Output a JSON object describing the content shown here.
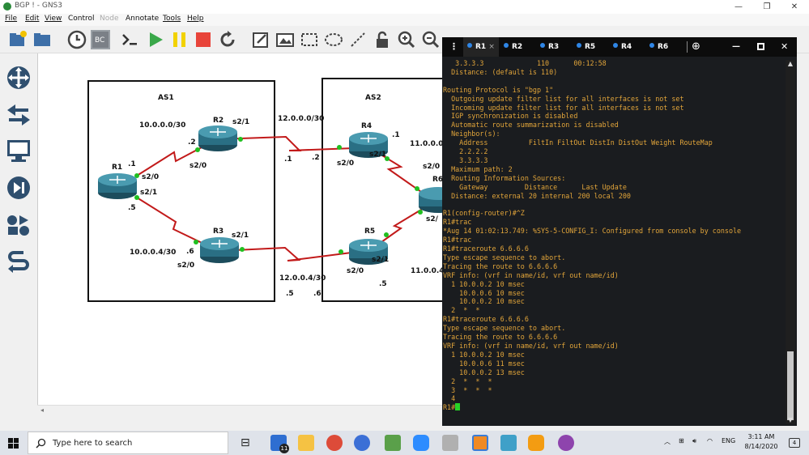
{
  "window": {
    "title": "BGP ! - GNS3",
    "min": "—",
    "restore": "❐",
    "close": "✕"
  },
  "menu": [
    "File",
    "Edit",
    "View",
    "Control",
    "Node",
    "Annotate",
    "Tools",
    "Help"
  ],
  "topology": {
    "labels": [
      {
        "text": "AS1"
      },
      {
        "text": "AS2"
      },
      {
        "text": "R1"
      },
      {
        "text": "R2"
      },
      {
        "text": "R3"
      },
      {
        "text": "R4"
      },
      {
        "text": "R5"
      },
      {
        "text": "R6"
      },
      {
        "text": "10.0.0.0/30"
      },
      {
        "text": "10.0.0.4/30"
      },
      {
        "text": "12.0.0.0/30"
      },
      {
        "text": "12.0.0.4/30"
      },
      {
        "text": "11.0.0.0/"
      },
      {
        "text": "11.0.0.4"
      },
      {
        "text": ".1"
      },
      {
        "text": ".5"
      },
      {
        "text": ".2"
      },
      {
        "text": ".6"
      },
      {
        "text": ".1"
      },
      {
        "text": ".2"
      },
      {
        "text": ".1"
      },
      {
        "text": ".5"
      },
      {
        "text": ".5"
      },
      {
        "text": ".6"
      },
      {
        "text": "s2/0"
      },
      {
        "text": "s2/1"
      },
      {
        "text": "s2/1"
      },
      {
        "text": "s2/0"
      },
      {
        "text": "s2/1"
      },
      {
        "text": "s2/0"
      },
      {
        "text": "s2/0"
      },
      {
        "text": "s2/1"
      },
      {
        "text": "s2/0"
      },
      {
        "text": "s2/1"
      },
      {
        "text": "s2/0"
      },
      {
        "text": "s2/"
      }
    ]
  },
  "console": {
    "tabs": [
      "R1",
      "R2",
      "R3",
      "R5",
      "R4",
      "R6"
    ],
    "close_x": "×",
    "add": "⊕",
    "lines": [
      "   3.3.3.3             110      00:12:58",
      "  Distance: (default is 110)",
      "",
      "Routing Protocol is \"bgp 1\"",
      "  Outgoing update filter list for all interfaces is not set",
      "  Incoming update filter list for all interfaces is not set",
      "  IGP synchronization is disabled",
      "  Automatic route summarization is disabled",
      "  Neighbor(s):",
      "    Address          FiltIn FiltOut DistIn DistOut Weight RouteMap",
      "    2.2.2.2",
      "    3.3.3.3",
      "  Maximum path: 2",
      "  Routing Information Sources:",
      "    Gateway         Distance      Last Update",
      "  Distance: external 20 internal 200 local 200",
      "",
      "R1(config-router)#^Z",
      "R1#trac",
      "*Aug 14 01:02:13.749: %SYS-5-CONFIG_I: Configured from console by console",
      "R1#trac",
      "R1#traceroute 6.6.6.6",
      "Type escape sequence to abort.",
      "Tracing the route to 6.6.6.6",
      "VRF info: (vrf in name/id, vrf out name/id)",
      "  1 10.0.0.2 10 msec",
      "    10.0.0.6 10 msec",
      "    10.0.0.2 10 msec",
      "  2  *  *",
      "R1#traceroute 6.6.6.6",
      "Type escape sequence to abort.",
      "Tracing the route to 6.6.6.6",
      "VRF info: (vrf in name/id, vrf out name/id)",
      "  1 10.0.0.2 10 msec",
      "    10.0.0.6 11 msec",
      "    10.0.0.2 13 msec",
      "  2  *  *  *",
      "  3  *  *  *",
      "  4",
      "R1#"
    ]
  },
  "taskbar": {
    "search_placeholder": "Type here to search",
    "mail_badge": "11",
    "tray": {
      "lang": "ENG",
      "time": "3:11 AM",
      "date": "8/14/2020",
      "notify": "4"
    }
  }
}
